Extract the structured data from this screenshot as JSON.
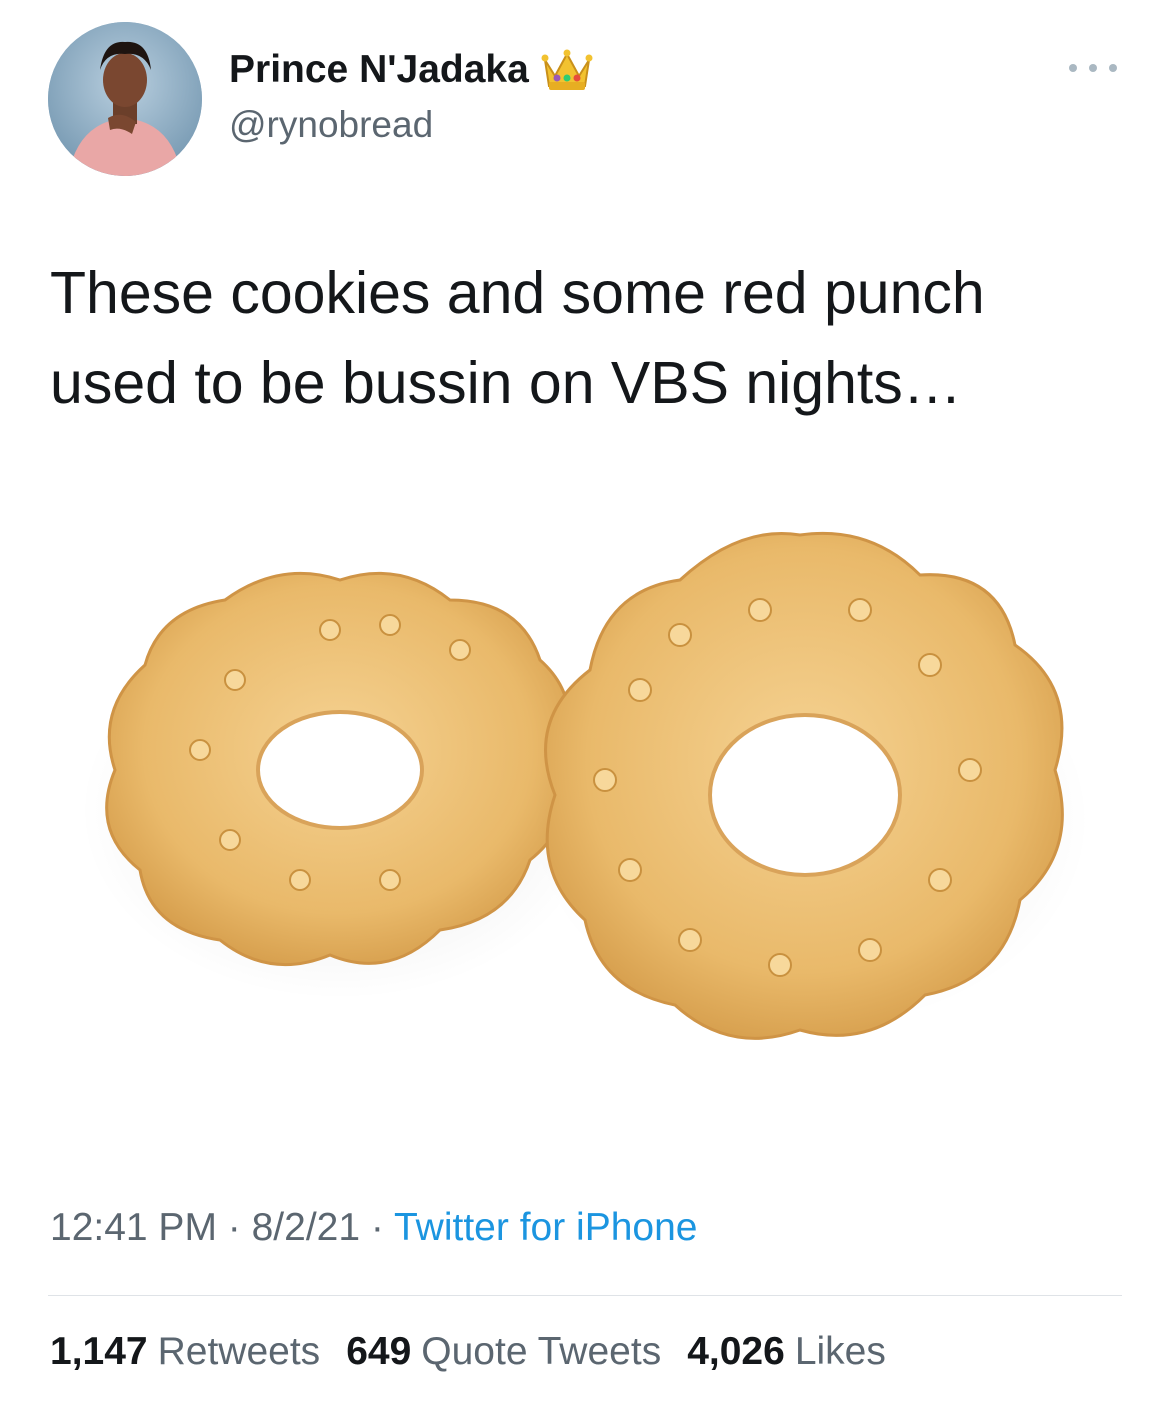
{
  "user": {
    "name": "Prince N'Jadaka",
    "handle": "@rynobread",
    "badge_icon": "crown-icon"
  },
  "tweet": {
    "text": "These cookies and some red punch\nused to be bussin on VBS nights…",
    "time": "12:41 PM",
    "sep1": " · ",
    "date": "8/2/21",
    "sep2": " · ",
    "source": "Twitter for iPhone"
  },
  "stats": {
    "retweets_count": "1,147",
    "retweets_label": "Retweets",
    "quotes_count": "649",
    "quotes_label": "Quote Tweets",
    "likes_count": "4,026",
    "likes_label": "Likes"
  },
  "colors": {
    "link": "#1b95e0",
    "secondary_text": "#5b6670",
    "cookie": "#e9b96a"
  }
}
